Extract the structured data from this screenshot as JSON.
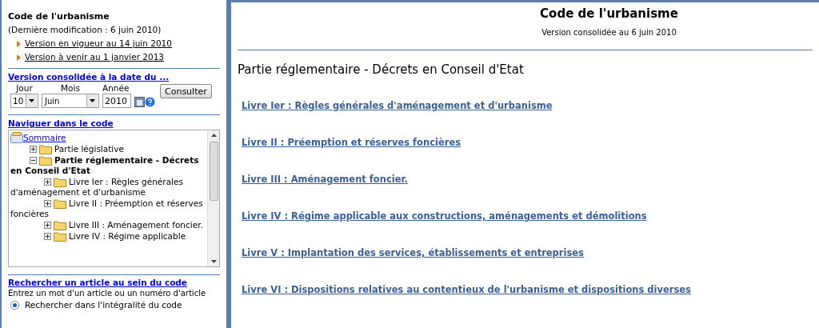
{
  "sidebar": {
    "code_title": "Code de l'urbanisme",
    "last_modified": "(Dernière modification : 6 juin 2010)",
    "version_links": [
      "Version en vigueur au 14 juin 2010",
      "Version à venir au 1 janvier 2013"
    ],
    "date_form": {
      "heading": "Version consolidée à la date du ...",
      "day_label": "Jour",
      "day": "10",
      "month_label": "Mois",
      "month": "Juin",
      "year_label": "Année",
      "year": "2010",
      "submit": "Consulter"
    },
    "navigation": {
      "heading": "Naviguer dans le code",
      "tree": [
        {
          "label": "Sommaire",
          "kind": "root",
          "children": [
            {
              "label": "Partie législative",
              "kind": "folder",
              "expanded": false,
              "selected": false
            },
            {
              "label": "Partie réglementaire - Décrets en Conseil d'Etat",
              "kind": "folder",
              "expanded": true,
              "selected": true,
              "children": [
                {
                  "label": "Livre Ier : Règles générales d'aménagement et d'urbanisme",
                  "kind": "folder",
                  "expanded": false,
                  "selected": false
                },
                {
                  "label": "Livre II : Préemption et réserves foncières",
                  "kind": "folder",
                  "expanded": false,
                  "selected": false
                },
                {
                  "label": "Livre III : Aménagement foncier.",
                  "kind": "folder",
                  "expanded": false,
                  "selected": false
                },
                {
                  "label": "Livre IV : Régime applicable",
                  "kind": "folder",
                  "expanded": false,
                  "selected": false
                }
              ]
            }
          ]
        }
      ]
    },
    "search": {
      "heading": "Rechercher un article au sein du code",
      "hint": "Entrez un mot d'un article ou un numéro d'article",
      "options": [
        {
          "label": "Rechercher dans l'intégralité du code",
          "selected": true
        }
      ]
    }
  },
  "main": {
    "title": "Code de l'urbanisme",
    "subtitle": "Version consolidée au 6 juin 2010",
    "section": "Partie réglementaire - Décrets en Conseil d'Etat",
    "books": [
      "Livre Ier : Règles générales d'aménagement et d'urbanisme",
      "Livre II : Préemption et réserves foncières",
      "Livre III : Aménagement foncier.",
      "Livre IV : Régime applicable aux constructions, aménagements et démolitions",
      "Livre V : Implantation des services, établissements et entreprises",
      "Livre VI : Dispositions relatives au contentieux de l'urbanisme et dispositions diverses"
    ]
  }
}
